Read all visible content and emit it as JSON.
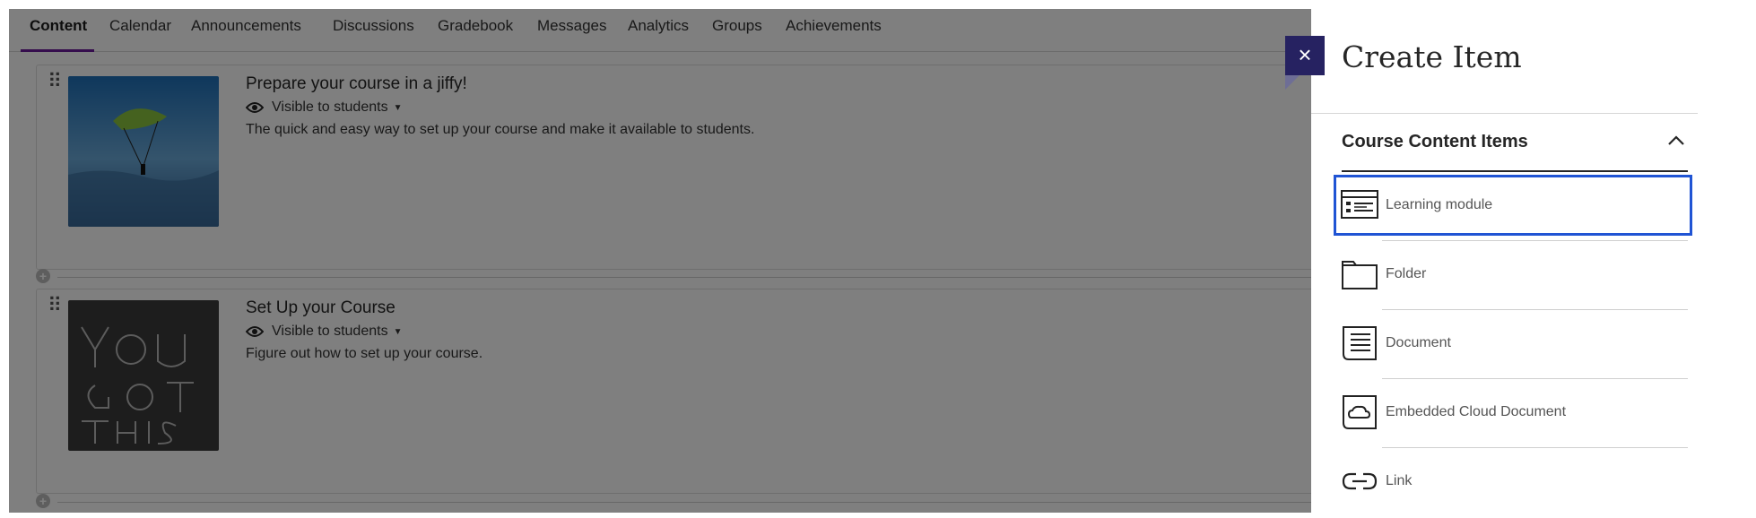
{
  "tabs": [
    "Content",
    "Calendar",
    "Announcements",
    "Discussions",
    "Gradebook",
    "Messages",
    "Analytics",
    "Groups",
    "Achievements"
  ],
  "cards": [
    {
      "title": "Prepare your course in a jiffy!",
      "visibility": "Visible to students",
      "description": "The quick and easy way to set up your course and make it available to students.",
      "image_icon": "parachute-image"
    },
    {
      "title": "Set Up your Course",
      "visibility": "Visible to students",
      "description": "Figure out how to set up your course.",
      "image_icon": "you-got-this-chalk-image"
    }
  ],
  "panel": {
    "close_label": "×",
    "title": "Create Item",
    "section": "Course Content Items",
    "items": [
      {
        "label": "Learning module",
        "icon": "learning-module-icon",
        "selected": true
      },
      {
        "label": "Folder",
        "icon": "folder-icon"
      },
      {
        "label": "Document",
        "icon": "document-icon"
      },
      {
        "label": "Embedded Cloud Document",
        "icon": "cloud-document-icon"
      },
      {
        "label": "Link",
        "icon": "link-icon"
      }
    ]
  },
  "colors": {
    "accent_tab": "#6a1b9a",
    "close_button": "#262261",
    "selected_outline": "#2054d4"
  }
}
